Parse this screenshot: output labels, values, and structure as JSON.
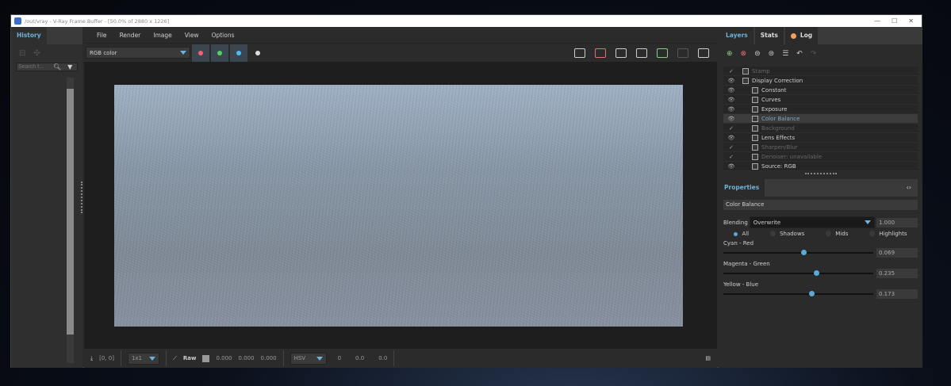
{
  "window": {
    "title": "/out/vray - V-Ray Frame Buffer - [50.0% of 2880 x 1226]"
  },
  "left": {
    "tab": "History",
    "search_placeholder": "Search f..."
  },
  "menu": [
    "File",
    "Render",
    "Image",
    "View",
    "Options"
  ],
  "toolbar": {
    "channel": "RGB color",
    "channel_colors": [
      "#f06070",
      "#50d060",
      "#50b8f0"
    ]
  },
  "right": {
    "tabs": [
      "Layers",
      "Stats",
      "Log"
    ],
    "log_dot": "#f0a060",
    "layers": [
      {
        "label": "Stamp",
        "visible": false
      },
      {
        "label": "Display Correction",
        "visible": true
      },
      {
        "label": "Constant",
        "visible": true
      },
      {
        "label": "Curves",
        "visible": true
      },
      {
        "label": "Exposure",
        "visible": true
      },
      {
        "label": "Color Balance",
        "visible": true,
        "selected": true
      },
      {
        "label": "Background",
        "visible": false
      },
      {
        "label": "Lens Effects",
        "visible": true
      },
      {
        "label": "Sharpen/Blur",
        "visible": false
      },
      {
        "label": "Denoiser: unavailable",
        "visible": false
      },
      {
        "label": "Source: RGB",
        "visible": true
      }
    ]
  },
  "properties": {
    "tab": "Properties",
    "layer_name": "Color Balance",
    "blending_label": "Blending",
    "blending": "Overwrite",
    "opacity": "1.000",
    "ranges": [
      "All",
      "Shadows",
      "Mids",
      "Highlights"
    ],
    "selected_range": "All",
    "sliders": [
      {
        "label": "Cyan - Red",
        "value": "0.069"
      },
      {
        "label": "Magenta - Green",
        "value": "0.235"
      },
      {
        "label": "Yellow - Blue",
        "value": "0.173"
      }
    ]
  },
  "bottom": {
    "coords": "[0, 0]",
    "zoom": "1x1",
    "raw": "Raw",
    "rgb": [
      "0.000",
      "0.000",
      "0.000"
    ],
    "mode": "HSV",
    "hsv": [
      "0",
      "0.0",
      "0.0"
    ]
  }
}
